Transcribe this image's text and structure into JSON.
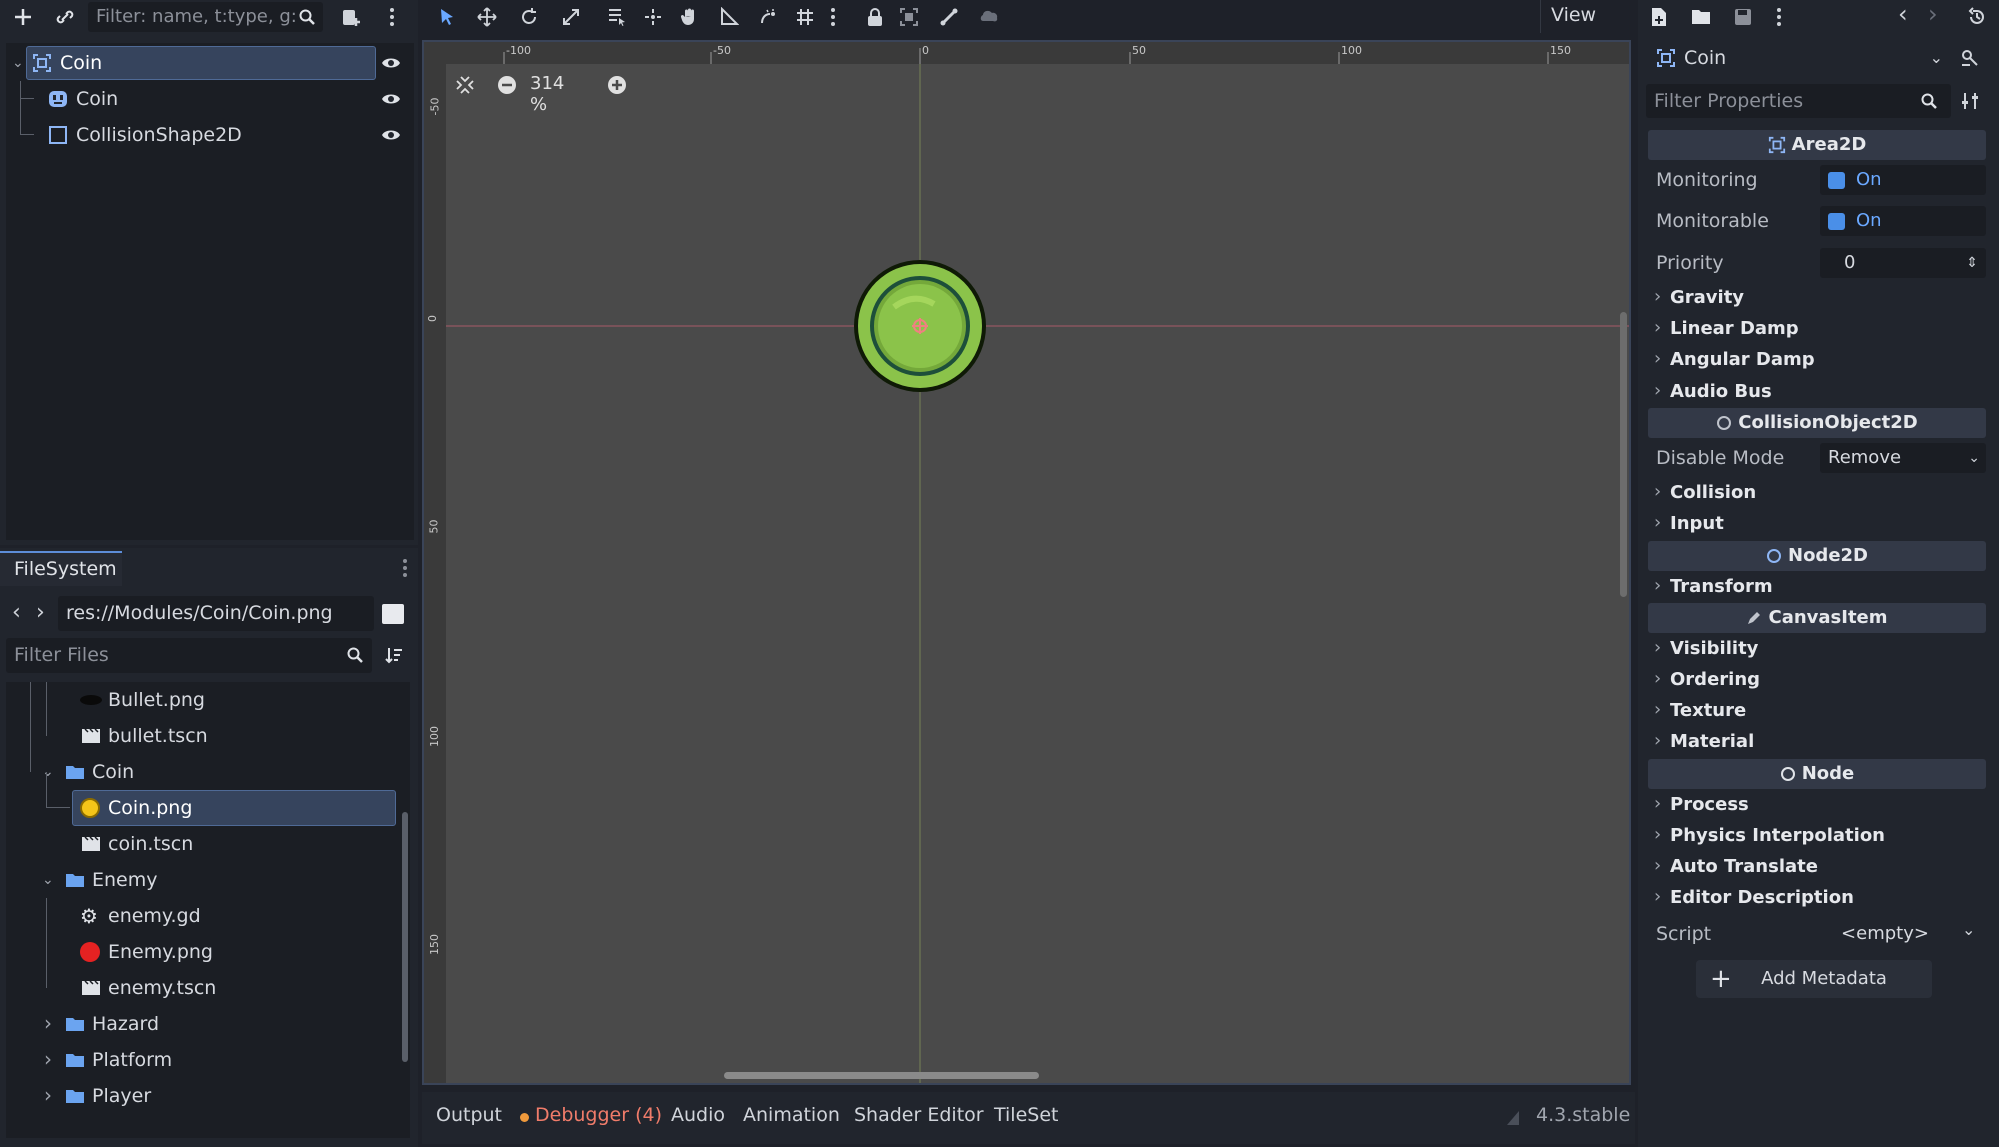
{
  "scene_dock": {
    "filter_placeholder": "Filter: name, t:type, g:",
    "tree": [
      {
        "label": "Coin",
        "type": "Area2D",
        "selected": true
      },
      {
        "label": "Coin",
        "type": "AnimatedSprite2D"
      },
      {
        "label": "CollisionShape2D",
        "type": "CollisionShape2D"
      }
    ]
  },
  "filesystem": {
    "tab_label": "FileSystem",
    "path": "res://Modules/Coin/Coin.png",
    "filter_placeholder": "Filter Files",
    "items": [
      {
        "label": "Bullet.png",
        "icon": "bullet-image-icon",
        "indent": 2
      },
      {
        "label": "bullet.tscn",
        "icon": "scene-icon",
        "indent": 2
      },
      {
        "label": "Coin",
        "icon": "folder-icon",
        "indent": 1,
        "expanded": true
      },
      {
        "label": "Coin.png",
        "icon": "coin-image-icon",
        "indent": 2,
        "selected": true
      },
      {
        "label": "coin.tscn",
        "icon": "scene-icon",
        "indent": 2
      },
      {
        "label": "Enemy",
        "icon": "folder-icon",
        "indent": 1,
        "expanded": true
      },
      {
        "label": "enemy.gd",
        "icon": "gear-icon",
        "indent": 2
      },
      {
        "label": "Enemy.png",
        "icon": "enemy-image-icon",
        "indent": 2
      },
      {
        "label": "enemy.tscn",
        "icon": "scene-icon",
        "indent": 2
      },
      {
        "label": "Hazard",
        "icon": "folder-icon",
        "indent": 1,
        "expanded": false
      },
      {
        "label": "Platform",
        "icon": "folder-icon",
        "indent": 1,
        "expanded": false
      },
      {
        "label": "Player",
        "icon": "folder-icon",
        "indent": 1,
        "expanded": false
      }
    ]
  },
  "toolbar": {
    "view_label": "View"
  },
  "viewport": {
    "zoom": "314 %",
    "ruler_top": [
      "-100",
      "-50",
      "0",
      "50",
      "100",
      "150"
    ],
    "ruler_left": [
      "-50",
      "0",
      "50",
      "100",
      "150"
    ]
  },
  "bottom_panel": {
    "tabs": [
      "Output",
      "Debugger (4)",
      "Audio",
      "Animation",
      "Shader Editor",
      "TileSet"
    ],
    "version": "4.3.stable"
  },
  "inspector": {
    "node_name": "Coin",
    "filter_placeholder": "Filter Properties",
    "sections": {
      "area2d": "Area2D",
      "collision_object": "CollisionObject2D",
      "node2d": "Node2D",
      "canvas_item": "CanvasItem",
      "node": "Node"
    },
    "props": {
      "monitoring_label": "Monitoring",
      "monitoring_value": "On",
      "monitorable_label": "Monitorable",
      "monitorable_value": "On",
      "priority_label": "Priority",
      "priority_value": "0",
      "disable_mode_label": "Disable Mode",
      "disable_mode_value": "Remove",
      "script_label": "Script",
      "script_value": "<empty>"
    },
    "groups": {
      "gravity": "Gravity",
      "linear_damp": "Linear Damp",
      "angular_damp": "Angular Damp",
      "audio_bus": "Audio Bus",
      "collision": "Collision",
      "input": "Input",
      "transform": "Transform",
      "visibility": "Visibility",
      "ordering": "Ordering",
      "texture": "Texture",
      "material": "Material",
      "process": "Process",
      "physics_interpolation": "Physics Interpolation",
      "auto_translate": "Auto Translate",
      "editor_description": "Editor Description"
    },
    "add_metadata": "Add Metadata"
  },
  "colors": {
    "accent": "#5d8dd8",
    "selection": "#36445d",
    "debugger": "#f07c6a",
    "coin_green": "#8bc34a",
    "enemy_red": "#e52222"
  }
}
